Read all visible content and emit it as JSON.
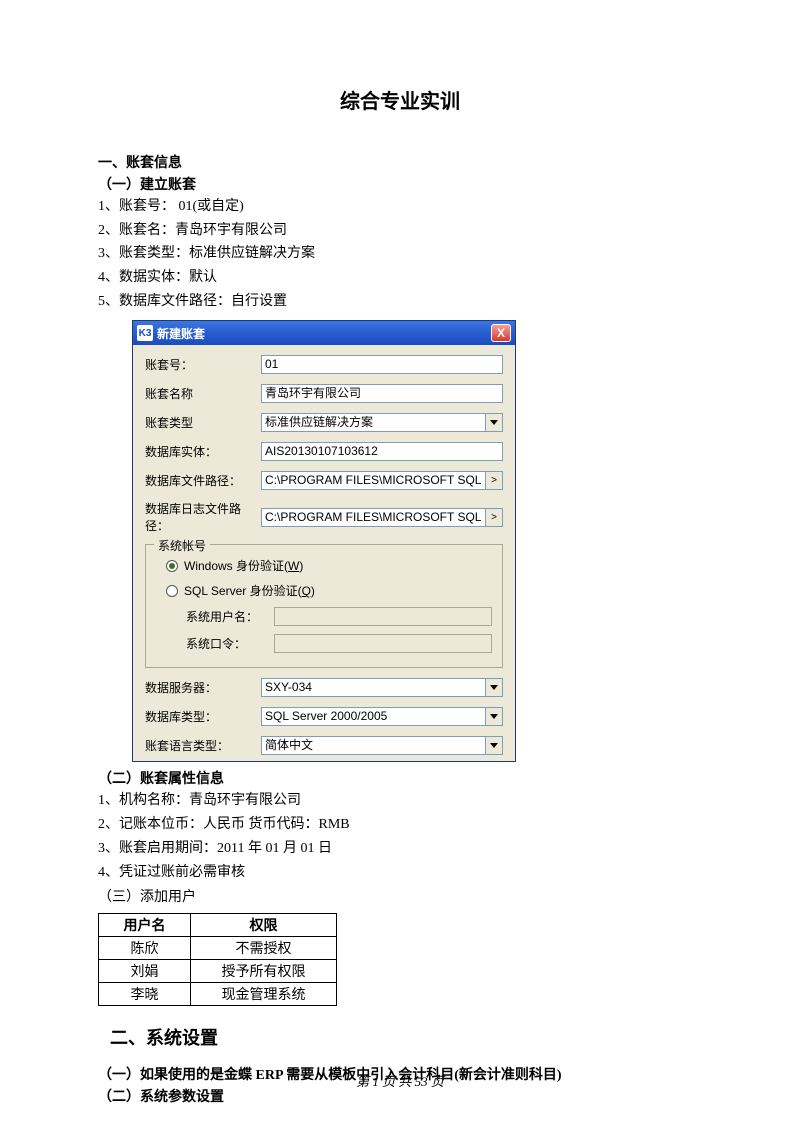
{
  "doc": {
    "title": "综合专业实训",
    "s1": {
      "h": "一、账套信息",
      "sub1": "（一）建立账套",
      "l1": "1、账套号：  01(或自定)",
      "l2": "2、账套名：青岛环宇有限公司",
      "l3": "3、账套类型：标准供应链解决方案",
      "l4": "4、数据实体：默认",
      "l5": "5、数据库文件路径：自行设置"
    },
    "dialog": {
      "appicon": "K3",
      "title": "新建账套",
      "close": "X",
      "labels": {
        "acctno": "账套号：",
        "acctname": "账套名称",
        "accttype": "账套类型",
        "dbentity": "数据库实体：",
        "dbpath": "数据库文件路径：",
        "logpath": "数据库日志文件路径：",
        "fieldset": "系统帐号",
        "radio1a": "Windows 身份验证(",
        "radio1u": "W",
        "radio1b": ")",
        "radio2a": "SQL Server 身份验证(",
        "radio2u": "Q",
        "radio2b": ")",
        "sysuser": "系统用户名：",
        "syspwd": "系统口令：",
        "dataserver": "数据服务器：",
        "dbtype": "数据库类型：",
        "lang": "账套语言类型："
      },
      "values": {
        "acctno": "01",
        "acctname": "青岛环宇有限公司",
        "accttype": "标准供应链解决方案",
        "dbentity": "AIS20130107103612",
        "dbpath": "C:\\PROGRAM FILES\\MICROSOFT SQL",
        "logpath": "C:\\PROGRAM FILES\\MICROSOFT SQL",
        "dataserver": "SXY-034",
        "dbtype": "SQL Server 2000/2005",
        "lang": "简体中文",
        "browse": ">"
      }
    },
    "s1b": {
      "sub2": "（二）账套属性信息",
      "l1": "1、机构名称：青岛环宇有限公司",
      "l2": "2、记账本位币：人民币    货币代码：RMB",
      "l3": "3、账套启用期间：2011 年 01 月 01 日",
      "l4": "4、凭证过账前必需审核",
      "sub3": "（三）添加用户"
    },
    "table": {
      "h1": "用户名",
      "h2": "权限",
      "rows": [
        {
          "c1": "陈欣",
          "c2": "不需授权"
        },
        {
          "c1": "刘娟",
          "c2": "授予所有权限"
        },
        {
          "c1": "李晓",
          "c2": "现金管理系统"
        }
      ]
    },
    "s2": {
      "h": "二、系统设置",
      "l1": "（一）如果使用的是金蝶 ERP 需要从模板中引入会计科目(新会计准则科目)",
      "l2": "（二）系统参数设置"
    },
    "footer": "第 1 页 共 53 页"
  }
}
